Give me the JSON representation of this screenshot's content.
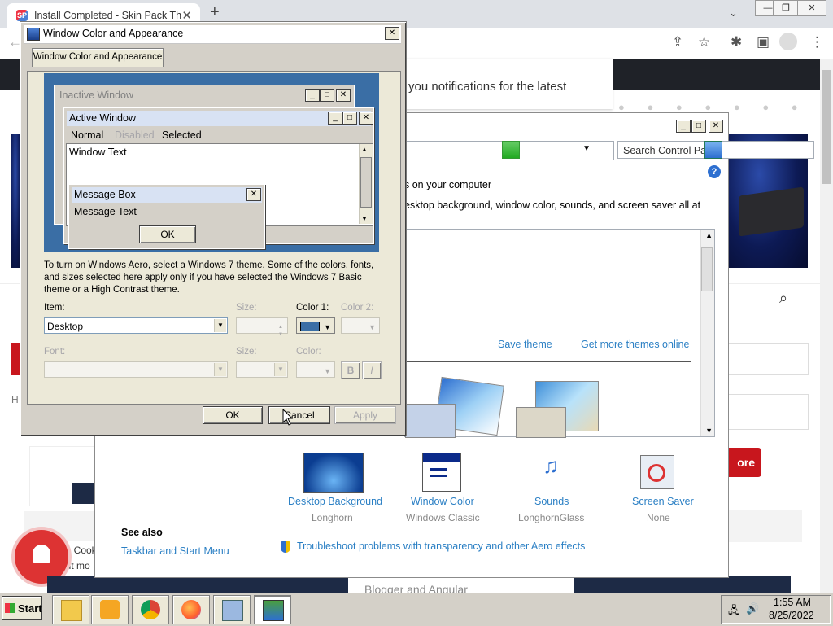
{
  "browser": {
    "tab_title": "Install Completed - Skin Pack The",
    "tab_favicon": "SP",
    "tab_close": "✕",
    "new_tab": "+",
    "window_controls": [
      "—",
      "❐",
      "✕"
    ]
  },
  "webpage": {
    "notification_text": "you notifications for the latest",
    "more_button": "ore",
    "cookie_text_1": "y & Cook",
    "cookie_text_2": "d out mo",
    "footer_text": "Blogger and Angular",
    "side_letter_h": "H"
  },
  "control_panel": {
    "search_placeholder": "Search Control Panel",
    "heading_fragment": "s on your computer",
    "desc_fragment": "esktop background, window color, sounds, and screen saver all at",
    "save_theme": "Save theme",
    "get_more_themes": "Get more themes online",
    "items": [
      {
        "label": "Desktop Background",
        "sub": "Longhorn"
      },
      {
        "label": "Window Color",
        "sub": "Windows Classic"
      },
      {
        "label": "Sounds",
        "sub": "LonghornGlass"
      },
      {
        "label": "Screen Saver",
        "sub": "None"
      }
    ],
    "see_also": "See also",
    "taskbar_link": "Taskbar and Start Menu",
    "troubleshoot_link": "Troubleshoot problems with transparency and other Aero effects"
  },
  "dialog": {
    "title": "Window Color and Appearance",
    "tab": "Window Color and Appearance",
    "preview": {
      "inactive_window": "Inactive Window",
      "active_window": "Active Window",
      "menu_normal": "Normal",
      "menu_disabled": "Disabled",
      "menu_selected": "Selected",
      "window_text": "Window Text",
      "message_box": "Message Box",
      "message_text": "Message Text",
      "ok": "OK"
    },
    "info_text": "To turn on Windows Aero, select a Windows 7 theme.  Some of the colors, fonts, and sizes selected here apply only if you have selected the Windows 7 Basic theme or a High Contrast theme.",
    "item_label": "Item:",
    "item_value": "Desktop",
    "size_label": "Size:",
    "color1_label": "Color 1:",
    "color2_label": "Color 2:",
    "font_label": "Font:",
    "size2_label": "Size:",
    "color_label": "Color:",
    "bold": "B",
    "italic": "I",
    "ok": "OK",
    "cancel": "Cancel",
    "apply": "Apply",
    "color1_swatch": "#3a6ea5"
  },
  "taskbar": {
    "start": "Start",
    "time": "1:55 AM",
    "date": "8/25/2022",
    "apps": [
      "file-explorer",
      "media-player",
      "chrome",
      "firefox",
      "control-panel",
      "display-settings"
    ]
  },
  "colors": {
    "dialog_face": "#d4d0c8",
    "desktop_blue": "#3a6ea5",
    "link_blue": "#2a7fc4",
    "active_caption": "#d8e2f3"
  }
}
